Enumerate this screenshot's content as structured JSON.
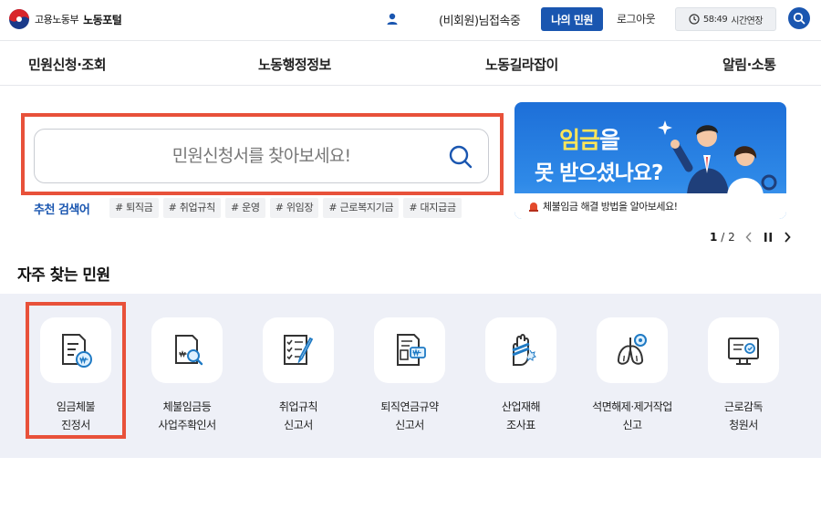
{
  "header": {
    "ministry": "고용노동부",
    "portal": "노동포털",
    "user_status": "(비회원)님접속중",
    "my_minwon_label": "나의 민원",
    "logout_label": "로그아웃",
    "session_time": "58:49",
    "extend_label": "시간연장",
    "accent_color": "#1a56b0"
  },
  "gnb": {
    "items": [
      "민원신청·조회",
      "노동행정정보",
      "노동길라잡이",
      "알림·소통"
    ]
  },
  "search": {
    "placeholder": "민원신청서를 찾아보세요!",
    "recommend_label": "추천 검색어",
    "tags": [
      "# 퇴직금",
      "# 취업규칙",
      "# 운영",
      "# 위임장",
      "# 근로복지기금",
      "# 대지급금"
    ],
    "highlight_color": "#e8513a"
  },
  "banner": {
    "line1_accent": "임금",
    "line1_rest": "을",
    "line2": "못 받으셨나요?",
    "caption": "체불임금 해결 방법을 알아보세요!",
    "page_current": "1",
    "page_sep": "/",
    "page_total": "2"
  },
  "frequent": {
    "title": "자주 찾는 민원",
    "items": [
      {
        "line1": "임금체불",
        "line2": "진정서",
        "icon": "wage-document-icon"
      },
      {
        "line1": "체불임금등",
        "line2": "사업주확인서",
        "icon": "document-search-icon"
      },
      {
        "line1": "취업규칙",
        "line2": "신고서",
        "icon": "checklist-pen-icon"
      },
      {
        "line1": "퇴직연금규약",
        "line2": "신고서",
        "icon": "pension-document-icon"
      },
      {
        "line1": "산업재해",
        "line2": "조사표",
        "icon": "injured-hand-icon"
      },
      {
        "line1": "석면해제·제거작업",
        "line2": "신고",
        "icon": "lungs-icon"
      },
      {
        "line1": "근로감독",
        "line2": "청원서",
        "icon": "monitor-icon"
      }
    ]
  }
}
